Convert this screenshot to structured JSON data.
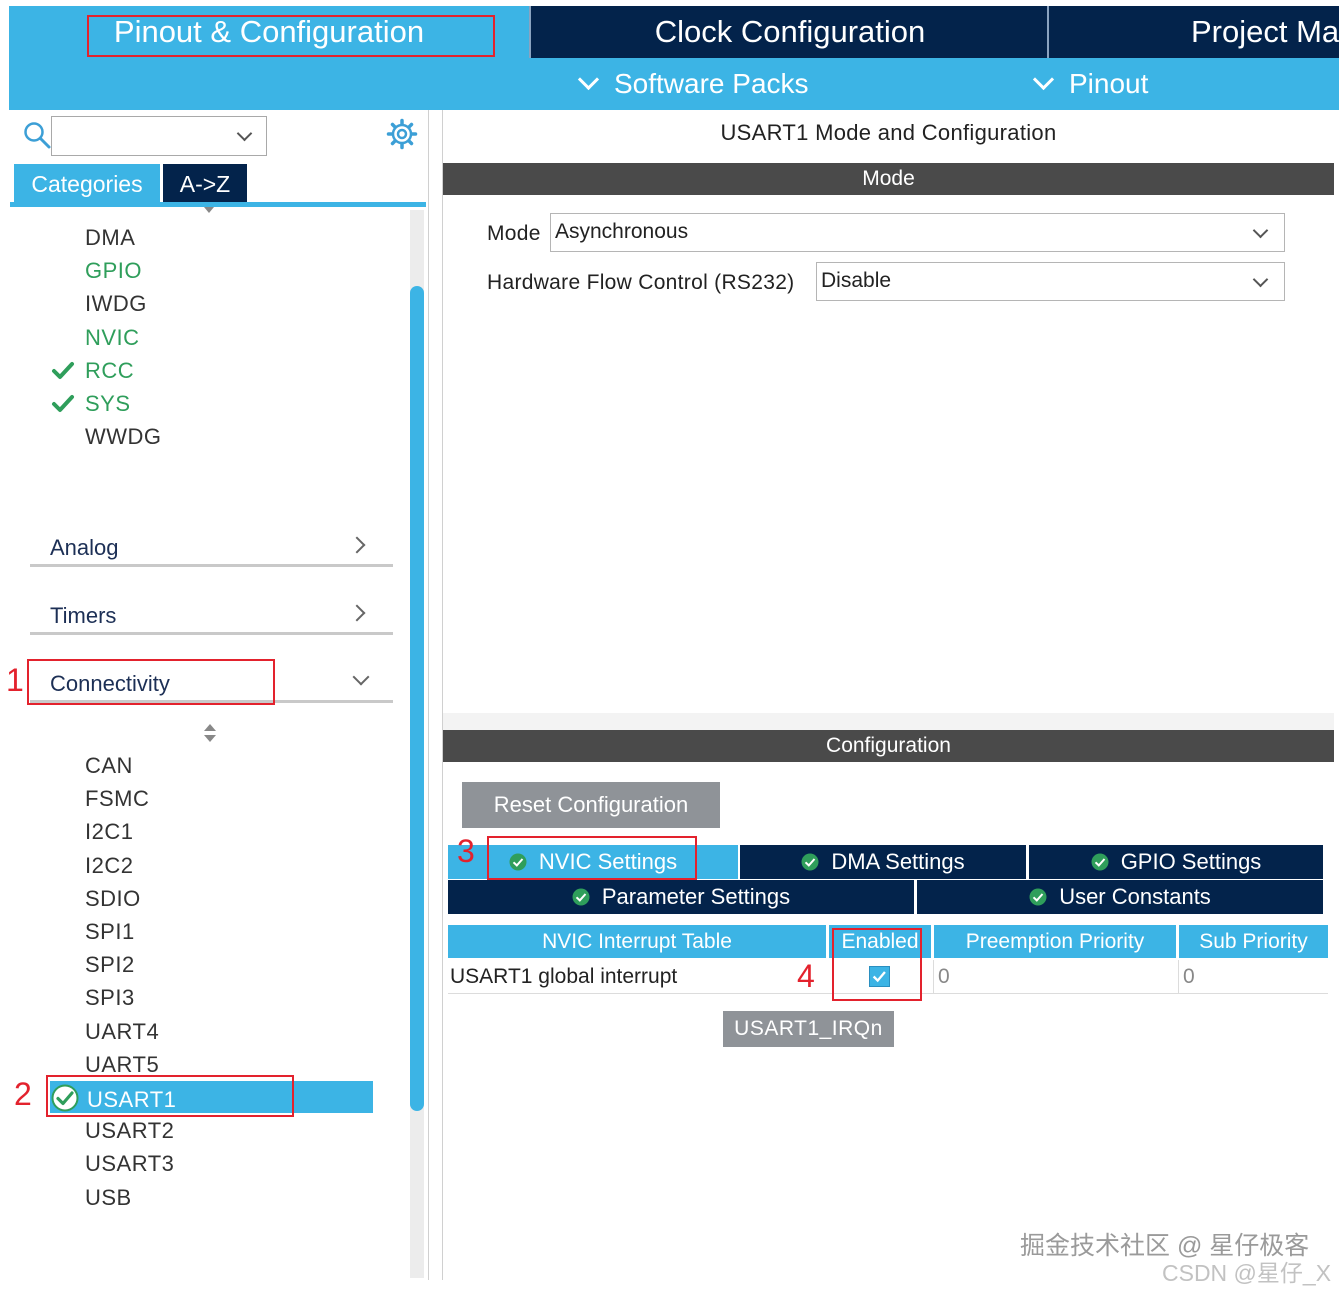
{
  "top_tabs": {
    "pinout": "Pinout & Configuration",
    "clock": "Clock Configuration",
    "project": "Project Ma"
  },
  "sub_menu": {
    "software_packs": "Software Packs",
    "pinout": "Pinout"
  },
  "left": {
    "search_value": "",
    "tabs": {
      "categories": "Categories",
      "atoz": "A->Z"
    },
    "system_core_items": [
      {
        "label": "DMA",
        "state": "normal"
      },
      {
        "label": "GPIO",
        "state": "green"
      },
      {
        "label": "IWDG",
        "state": "normal"
      },
      {
        "label": "NVIC",
        "state": "green"
      },
      {
        "label": "RCC",
        "state": "checked"
      },
      {
        "label": "SYS",
        "state": "checked"
      },
      {
        "label": "WWDG",
        "state": "normal"
      }
    ],
    "groups": {
      "analog": "Analog",
      "timers": "Timers",
      "connectivity": "Connectivity"
    },
    "connectivity_items": [
      "CAN",
      "FSMC",
      "I2C1",
      "I2C2",
      "SDIO",
      "SPI1",
      "SPI2",
      "SPI3",
      "UART4",
      "UART5",
      "USART1",
      "USART2",
      "USART3",
      "USB"
    ],
    "selected": "USART1"
  },
  "right": {
    "title": "USART1 Mode and Configuration",
    "mode_header": "Mode",
    "mode_label": "Mode",
    "mode_value": "Asynchronous",
    "flow_label": "Hardware Flow Control (RS232)",
    "flow_value": "Disable",
    "config_header": "Configuration",
    "reset_button": "Reset Configuration",
    "settings_tabs": {
      "nvic": "NVIC Settings",
      "dma": "DMA Settings",
      "gpio": "GPIO Settings",
      "parameter": "Parameter Settings",
      "user": "User Constants"
    },
    "table": {
      "headers": [
        "NVIC Interrupt Table",
        "Enabled",
        "Preemption Priority",
        "Sub Priority"
      ],
      "rows": [
        {
          "name": "USART1 global interrupt",
          "enabled": true,
          "preemption": "0",
          "sub": "0"
        }
      ]
    },
    "tooltip": "USART1_IRQn"
  },
  "annotations": {
    "n1": "1",
    "n2": "2",
    "n3": "3",
    "n4": "4"
  },
  "watermark": {
    "line1": "掘金技术社区 @ 星仔极客",
    "line2": "CSDN @星仔_X"
  },
  "colors": {
    "accent": "#3cb4e5",
    "navy": "#03234b",
    "ok_green": "#2f9e5b",
    "annotation_red": "#e3222d"
  }
}
